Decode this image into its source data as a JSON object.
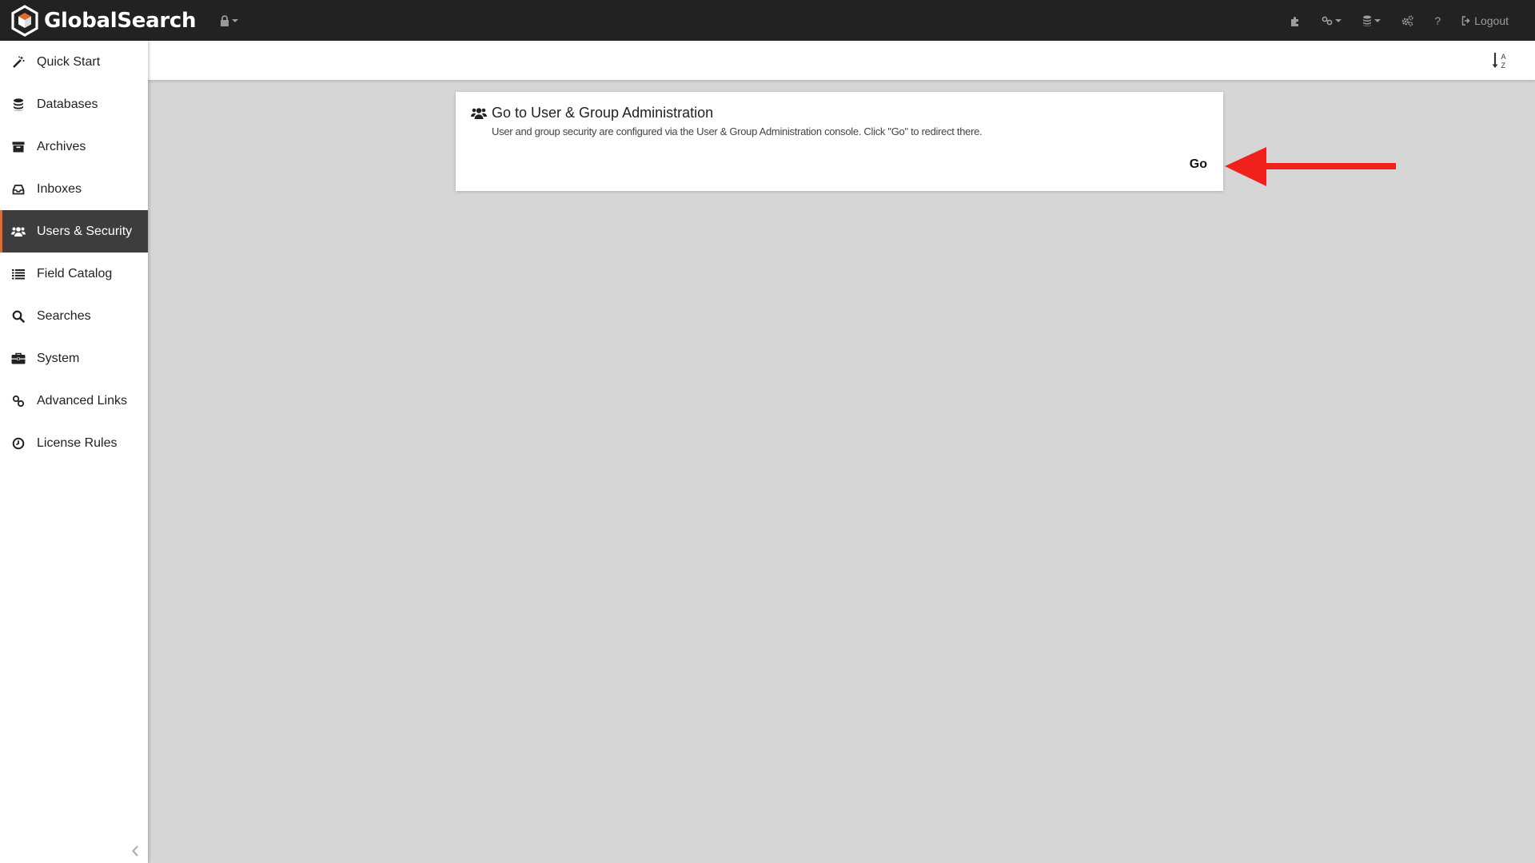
{
  "app": {
    "brand_name": "GlobalSearch",
    "accent_color": "#e26a2c"
  },
  "topbar": {
    "items": [
      {
        "icon": "puzzle-icon"
      },
      {
        "icon": "link-icon",
        "dropdown": true
      },
      {
        "icon": "database-icon",
        "dropdown": true
      },
      {
        "icon": "cogs-icon"
      },
      {
        "label": "?"
      },
      {
        "icon": "sign-out-icon",
        "label": "Logout"
      }
    ]
  },
  "sidebar": {
    "items": [
      {
        "label": "Quick Start",
        "icon": "magic-wand-icon"
      },
      {
        "label": "Databases",
        "icon": "database-icon"
      },
      {
        "label": "Archives",
        "icon": "archive-icon"
      },
      {
        "label": "Inboxes",
        "icon": "inbox-icon"
      },
      {
        "label": "Users & Security",
        "icon": "users-icon",
        "active": true
      },
      {
        "label": "Field Catalog",
        "icon": "list-icon"
      },
      {
        "label": "Searches",
        "icon": "search-icon"
      },
      {
        "label": "System",
        "icon": "briefcase-icon"
      },
      {
        "label": "Advanced Links",
        "icon": "link-icon"
      },
      {
        "label": "License Rules",
        "icon": "clock-icon"
      }
    ]
  },
  "card": {
    "title": "Go to User & Group Administration",
    "description": "User and group security are configured via the User & Group Administration console. Click \"Go\" to redirect there.",
    "button_label": "Go"
  },
  "annotation": {
    "arrow_color": "#f0201a"
  }
}
